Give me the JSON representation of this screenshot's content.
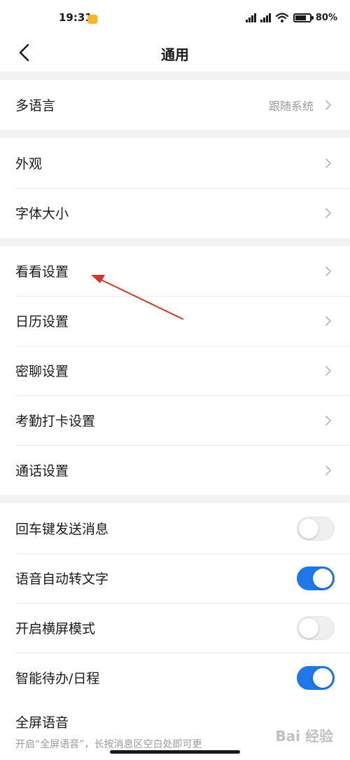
{
  "status_bar": {
    "time": "19:31",
    "battery": "80%",
    "battery_level": 0.8
  },
  "nav": {
    "title": "通用"
  },
  "groups": [
    {
      "rows": [
        {
          "label": "多语言",
          "value": "跟随系统"
        }
      ]
    },
    {
      "rows": [
        {
          "label": "外观"
        },
        {
          "label": "字体大小"
        }
      ]
    },
    {
      "rows": [
        {
          "label": "看看设置"
        },
        {
          "label": "日历设置"
        },
        {
          "label": "密聊设置"
        },
        {
          "label": "考勤打卡设置"
        },
        {
          "label": "通话设置"
        }
      ]
    },
    {
      "toggles": [
        {
          "label": "回车键发送消息",
          "on": false
        },
        {
          "label": "语音自动转文字",
          "on": true
        },
        {
          "label": "开启横屏模式",
          "on": false
        },
        {
          "label": "智能待办/日程",
          "on": true
        }
      ],
      "partial": {
        "label": "全屏语音",
        "desc": "开启“全屏语音”，长按消息区空白处即可更"
      }
    }
  ],
  "watermark": "Bai 经验",
  "colors": {
    "accent": "#1f77e8",
    "annotation": "#d9342b"
  }
}
